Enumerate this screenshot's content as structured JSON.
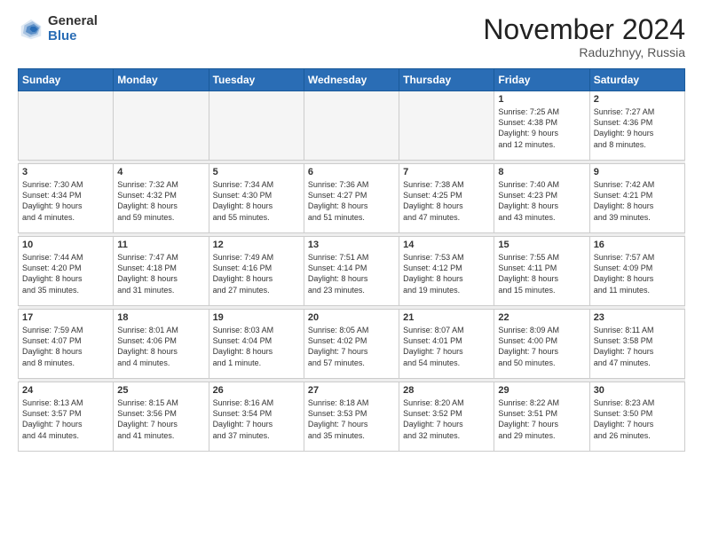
{
  "logo": {
    "general": "General",
    "blue": "Blue"
  },
  "header": {
    "month": "November 2024",
    "location": "Raduzhnyy, Russia"
  },
  "weekdays": [
    "Sunday",
    "Monday",
    "Tuesday",
    "Wednesday",
    "Thursday",
    "Friday",
    "Saturday"
  ],
  "weeks": [
    [
      {
        "day": "",
        "info": ""
      },
      {
        "day": "",
        "info": ""
      },
      {
        "day": "",
        "info": ""
      },
      {
        "day": "",
        "info": ""
      },
      {
        "day": "",
        "info": ""
      },
      {
        "day": "1",
        "info": "Sunrise: 7:25 AM\nSunset: 4:38 PM\nDaylight: 9 hours\nand 12 minutes."
      },
      {
        "day": "2",
        "info": "Sunrise: 7:27 AM\nSunset: 4:36 PM\nDaylight: 9 hours\nand 8 minutes."
      }
    ],
    [
      {
        "day": "3",
        "info": "Sunrise: 7:30 AM\nSunset: 4:34 PM\nDaylight: 9 hours\nand 4 minutes."
      },
      {
        "day": "4",
        "info": "Sunrise: 7:32 AM\nSunset: 4:32 PM\nDaylight: 8 hours\nand 59 minutes."
      },
      {
        "day": "5",
        "info": "Sunrise: 7:34 AM\nSunset: 4:30 PM\nDaylight: 8 hours\nand 55 minutes."
      },
      {
        "day": "6",
        "info": "Sunrise: 7:36 AM\nSunset: 4:27 PM\nDaylight: 8 hours\nand 51 minutes."
      },
      {
        "day": "7",
        "info": "Sunrise: 7:38 AM\nSunset: 4:25 PM\nDaylight: 8 hours\nand 47 minutes."
      },
      {
        "day": "8",
        "info": "Sunrise: 7:40 AM\nSunset: 4:23 PM\nDaylight: 8 hours\nand 43 minutes."
      },
      {
        "day": "9",
        "info": "Sunrise: 7:42 AM\nSunset: 4:21 PM\nDaylight: 8 hours\nand 39 minutes."
      }
    ],
    [
      {
        "day": "10",
        "info": "Sunrise: 7:44 AM\nSunset: 4:20 PM\nDaylight: 8 hours\nand 35 minutes."
      },
      {
        "day": "11",
        "info": "Sunrise: 7:47 AM\nSunset: 4:18 PM\nDaylight: 8 hours\nand 31 minutes."
      },
      {
        "day": "12",
        "info": "Sunrise: 7:49 AM\nSunset: 4:16 PM\nDaylight: 8 hours\nand 27 minutes."
      },
      {
        "day": "13",
        "info": "Sunrise: 7:51 AM\nSunset: 4:14 PM\nDaylight: 8 hours\nand 23 minutes."
      },
      {
        "day": "14",
        "info": "Sunrise: 7:53 AM\nSunset: 4:12 PM\nDaylight: 8 hours\nand 19 minutes."
      },
      {
        "day": "15",
        "info": "Sunrise: 7:55 AM\nSunset: 4:11 PM\nDaylight: 8 hours\nand 15 minutes."
      },
      {
        "day": "16",
        "info": "Sunrise: 7:57 AM\nSunset: 4:09 PM\nDaylight: 8 hours\nand 11 minutes."
      }
    ],
    [
      {
        "day": "17",
        "info": "Sunrise: 7:59 AM\nSunset: 4:07 PM\nDaylight: 8 hours\nand 8 minutes."
      },
      {
        "day": "18",
        "info": "Sunrise: 8:01 AM\nSunset: 4:06 PM\nDaylight: 8 hours\nand 4 minutes."
      },
      {
        "day": "19",
        "info": "Sunrise: 8:03 AM\nSunset: 4:04 PM\nDaylight: 8 hours\nand 1 minute."
      },
      {
        "day": "20",
        "info": "Sunrise: 8:05 AM\nSunset: 4:02 PM\nDaylight: 7 hours\nand 57 minutes."
      },
      {
        "day": "21",
        "info": "Sunrise: 8:07 AM\nSunset: 4:01 PM\nDaylight: 7 hours\nand 54 minutes."
      },
      {
        "day": "22",
        "info": "Sunrise: 8:09 AM\nSunset: 4:00 PM\nDaylight: 7 hours\nand 50 minutes."
      },
      {
        "day": "23",
        "info": "Sunrise: 8:11 AM\nSunset: 3:58 PM\nDaylight: 7 hours\nand 47 minutes."
      }
    ],
    [
      {
        "day": "24",
        "info": "Sunrise: 8:13 AM\nSunset: 3:57 PM\nDaylight: 7 hours\nand 44 minutes."
      },
      {
        "day": "25",
        "info": "Sunrise: 8:15 AM\nSunset: 3:56 PM\nDaylight: 7 hours\nand 41 minutes."
      },
      {
        "day": "26",
        "info": "Sunrise: 8:16 AM\nSunset: 3:54 PM\nDaylight: 7 hours\nand 37 minutes."
      },
      {
        "day": "27",
        "info": "Sunrise: 8:18 AM\nSunset: 3:53 PM\nDaylight: 7 hours\nand 35 minutes."
      },
      {
        "day": "28",
        "info": "Sunrise: 8:20 AM\nSunset: 3:52 PM\nDaylight: 7 hours\nand 32 minutes."
      },
      {
        "day": "29",
        "info": "Sunrise: 8:22 AM\nSunset: 3:51 PM\nDaylight: 7 hours\nand 29 minutes."
      },
      {
        "day": "30",
        "info": "Sunrise: 8:23 AM\nSunset: 3:50 PM\nDaylight: 7 hours\nand 26 minutes."
      }
    ]
  ]
}
